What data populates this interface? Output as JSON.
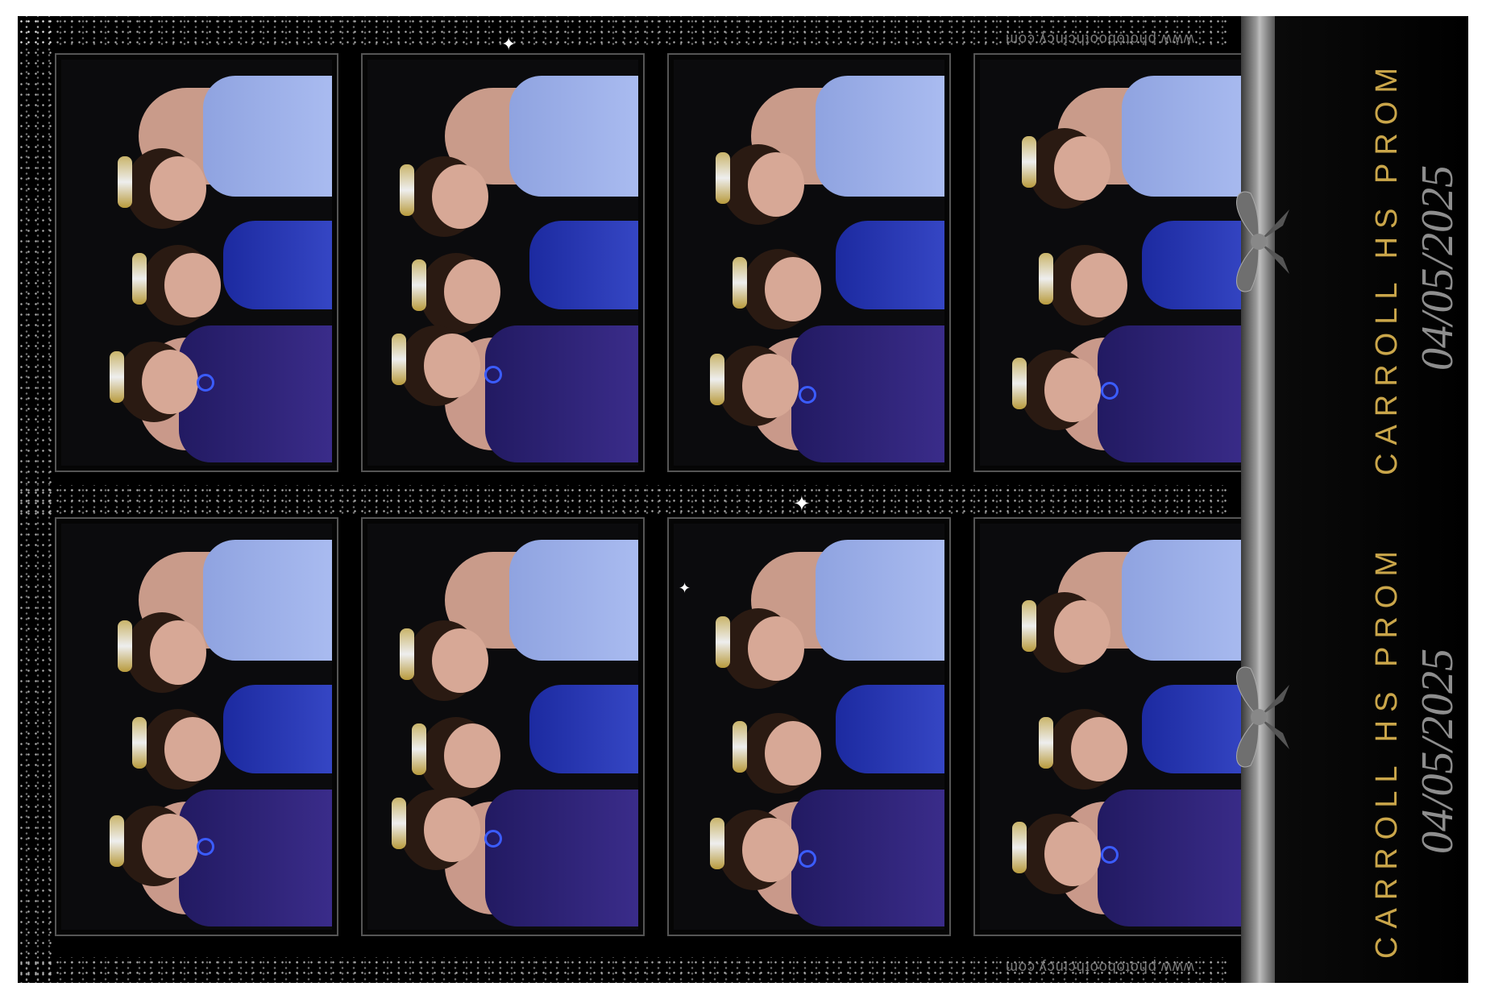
{
  "event": {
    "title": "CARROLL HS PROM",
    "date": "04/05/2025",
    "website": "www.photoboothcincy.com"
  },
  "strips": [
    {
      "name": "top-strip",
      "photo_count": 4
    },
    {
      "name": "bottom-strip",
      "photo_count": 4
    }
  ],
  "colors": {
    "background": "#000000",
    "title_gold": "#caa64a",
    "date_gray": "#8e8e8e",
    "ribbon_gray": "#9a9a9a",
    "dress_light_blue": "#a9bbf0",
    "dress_royal_blue": "#3546c4",
    "dress_purple": "#3a2c8a"
  },
  "icons": [
    "ribbon-bow-icon",
    "sparkle-icon"
  ]
}
